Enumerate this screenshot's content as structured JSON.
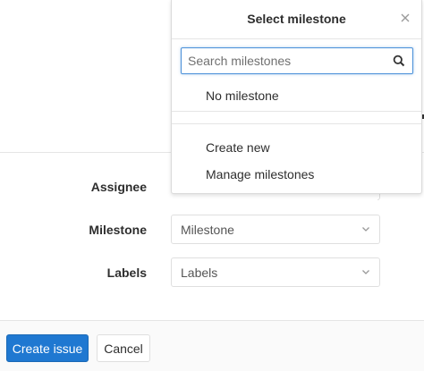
{
  "form": {
    "assignee": {
      "label": "Assignee"
    },
    "milestone": {
      "label": "Milestone",
      "value": "Milestone"
    },
    "labels": {
      "label": "Labels",
      "value": "Labels"
    }
  },
  "actions": {
    "create_label": "Create issue",
    "cancel_label": "Cancel"
  },
  "milestone_dropdown": {
    "title": "Select milestone",
    "search_placeholder": "Search milestones",
    "options": [
      "No milestone"
    ],
    "footer_links": [
      "Create new",
      "Manage milestones"
    ]
  },
  "colors": {
    "primary": "#1f78d1",
    "focus_border": "#4a90d9",
    "border": "#dfdfdf"
  },
  "icons": {
    "close": "close-icon",
    "search": "search-icon",
    "chevron": "chevron-down-icon"
  }
}
